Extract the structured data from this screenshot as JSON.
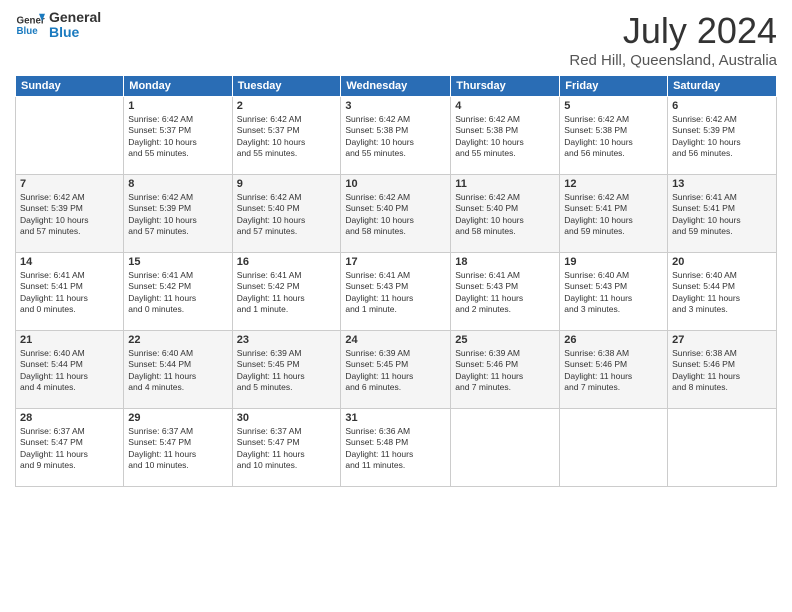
{
  "header": {
    "logo_line1": "General",
    "logo_line2": "Blue",
    "month_year": "July 2024",
    "location": "Red Hill, Queensland, Australia"
  },
  "weekdays": [
    "Sunday",
    "Monday",
    "Tuesday",
    "Wednesday",
    "Thursday",
    "Friday",
    "Saturday"
  ],
  "weeks": [
    [
      {
        "day": "",
        "info": ""
      },
      {
        "day": "1",
        "info": "Sunrise: 6:42 AM\nSunset: 5:37 PM\nDaylight: 10 hours\nand 55 minutes."
      },
      {
        "day": "2",
        "info": "Sunrise: 6:42 AM\nSunset: 5:37 PM\nDaylight: 10 hours\nand 55 minutes."
      },
      {
        "day": "3",
        "info": "Sunrise: 6:42 AM\nSunset: 5:38 PM\nDaylight: 10 hours\nand 55 minutes."
      },
      {
        "day": "4",
        "info": "Sunrise: 6:42 AM\nSunset: 5:38 PM\nDaylight: 10 hours\nand 55 minutes."
      },
      {
        "day": "5",
        "info": "Sunrise: 6:42 AM\nSunset: 5:38 PM\nDaylight: 10 hours\nand 56 minutes."
      },
      {
        "day": "6",
        "info": "Sunrise: 6:42 AM\nSunset: 5:39 PM\nDaylight: 10 hours\nand 56 minutes."
      }
    ],
    [
      {
        "day": "7",
        "info": "Sunrise: 6:42 AM\nSunset: 5:39 PM\nDaylight: 10 hours\nand 57 minutes."
      },
      {
        "day": "8",
        "info": "Sunrise: 6:42 AM\nSunset: 5:39 PM\nDaylight: 10 hours\nand 57 minutes."
      },
      {
        "day": "9",
        "info": "Sunrise: 6:42 AM\nSunset: 5:40 PM\nDaylight: 10 hours\nand 57 minutes."
      },
      {
        "day": "10",
        "info": "Sunrise: 6:42 AM\nSunset: 5:40 PM\nDaylight: 10 hours\nand 58 minutes."
      },
      {
        "day": "11",
        "info": "Sunrise: 6:42 AM\nSunset: 5:40 PM\nDaylight: 10 hours\nand 58 minutes."
      },
      {
        "day": "12",
        "info": "Sunrise: 6:42 AM\nSunset: 5:41 PM\nDaylight: 10 hours\nand 59 minutes."
      },
      {
        "day": "13",
        "info": "Sunrise: 6:41 AM\nSunset: 5:41 PM\nDaylight: 10 hours\nand 59 minutes."
      }
    ],
    [
      {
        "day": "14",
        "info": "Sunrise: 6:41 AM\nSunset: 5:41 PM\nDaylight: 11 hours\nand 0 minutes."
      },
      {
        "day": "15",
        "info": "Sunrise: 6:41 AM\nSunset: 5:42 PM\nDaylight: 11 hours\nand 0 minutes."
      },
      {
        "day": "16",
        "info": "Sunrise: 6:41 AM\nSunset: 5:42 PM\nDaylight: 11 hours\nand 1 minute."
      },
      {
        "day": "17",
        "info": "Sunrise: 6:41 AM\nSunset: 5:43 PM\nDaylight: 11 hours\nand 1 minute."
      },
      {
        "day": "18",
        "info": "Sunrise: 6:41 AM\nSunset: 5:43 PM\nDaylight: 11 hours\nand 2 minutes."
      },
      {
        "day": "19",
        "info": "Sunrise: 6:40 AM\nSunset: 5:43 PM\nDaylight: 11 hours\nand 3 minutes."
      },
      {
        "day": "20",
        "info": "Sunrise: 6:40 AM\nSunset: 5:44 PM\nDaylight: 11 hours\nand 3 minutes."
      }
    ],
    [
      {
        "day": "21",
        "info": "Sunrise: 6:40 AM\nSunset: 5:44 PM\nDaylight: 11 hours\nand 4 minutes."
      },
      {
        "day": "22",
        "info": "Sunrise: 6:40 AM\nSunset: 5:44 PM\nDaylight: 11 hours\nand 4 minutes."
      },
      {
        "day": "23",
        "info": "Sunrise: 6:39 AM\nSunset: 5:45 PM\nDaylight: 11 hours\nand 5 minutes."
      },
      {
        "day": "24",
        "info": "Sunrise: 6:39 AM\nSunset: 5:45 PM\nDaylight: 11 hours\nand 6 minutes."
      },
      {
        "day": "25",
        "info": "Sunrise: 6:39 AM\nSunset: 5:46 PM\nDaylight: 11 hours\nand 7 minutes."
      },
      {
        "day": "26",
        "info": "Sunrise: 6:38 AM\nSunset: 5:46 PM\nDaylight: 11 hours\nand 7 minutes."
      },
      {
        "day": "27",
        "info": "Sunrise: 6:38 AM\nSunset: 5:46 PM\nDaylight: 11 hours\nand 8 minutes."
      }
    ],
    [
      {
        "day": "28",
        "info": "Sunrise: 6:37 AM\nSunset: 5:47 PM\nDaylight: 11 hours\nand 9 minutes."
      },
      {
        "day": "29",
        "info": "Sunrise: 6:37 AM\nSunset: 5:47 PM\nDaylight: 11 hours\nand 10 minutes."
      },
      {
        "day": "30",
        "info": "Sunrise: 6:37 AM\nSunset: 5:47 PM\nDaylight: 11 hours\nand 10 minutes."
      },
      {
        "day": "31",
        "info": "Sunrise: 6:36 AM\nSunset: 5:48 PM\nDaylight: 11 hours\nand 11 minutes."
      },
      {
        "day": "",
        "info": ""
      },
      {
        "day": "",
        "info": ""
      },
      {
        "day": "",
        "info": ""
      }
    ]
  ]
}
